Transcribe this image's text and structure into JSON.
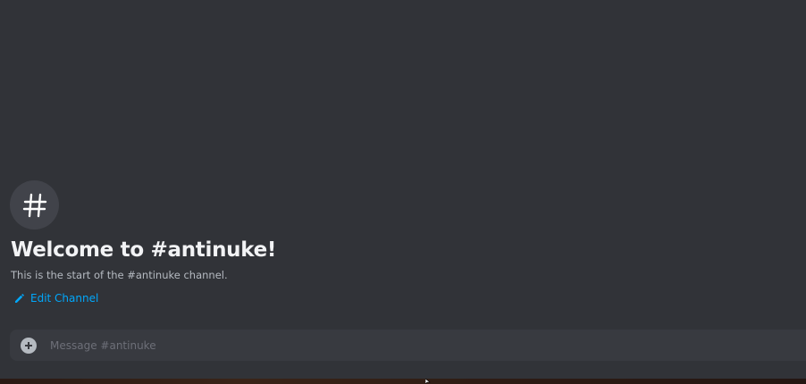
{
  "channel": {
    "welcome_title": "Welcome to #antinuke!",
    "welcome_subtitle": "This is the start of the #antinuke channel.",
    "edit_label": "Edit Channel"
  },
  "composer": {
    "placeholder": "Message #antinuke"
  },
  "icons": {
    "channel": "hash-icon",
    "edit": "pencil-icon",
    "attach": "plus-circle-icon"
  },
  "colors": {
    "background": "#313338",
    "accent_link": "#00a8fc",
    "title": "#f2f3f5",
    "muted_text": "#b5bac1"
  }
}
